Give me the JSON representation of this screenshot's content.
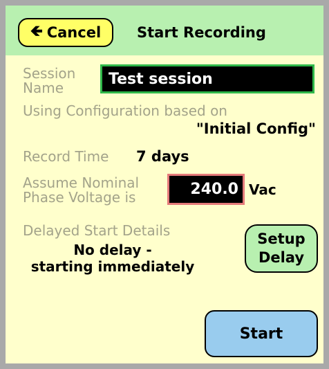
{
  "header": {
    "cancel_label": "Cancel",
    "title": "Start Recording"
  },
  "session": {
    "label_line1": "Session",
    "label_line2": "Name",
    "value": "Test session"
  },
  "configuration": {
    "label": "Using Configuration based on",
    "value": "\"Initial Config\""
  },
  "record_time": {
    "label": "Record Time",
    "value": "7 days"
  },
  "voltage": {
    "label_line1": "Assume Nominal",
    "label_line2": "Phase Voltage is",
    "value": "240.0",
    "unit": "Vac"
  },
  "delayed_start": {
    "label": "Delayed Start Details",
    "line1": "No delay -",
    "line2": "starting immediately",
    "setup_label": "Setup\nDelay"
  },
  "start_label": "Start",
  "icons": {
    "cancel": "arrow-left-icon"
  },
  "colors": {
    "screen_bg": "#ffffcc",
    "header_bg": "#b8f0b0",
    "cancel_bg": "#ffff66",
    "start_bg": "#99ccee",
    "session_border": "#2fb84a",
    "voltage_border": "#e57a7a",
    "label_text": "#a3a38a"
  }
}
